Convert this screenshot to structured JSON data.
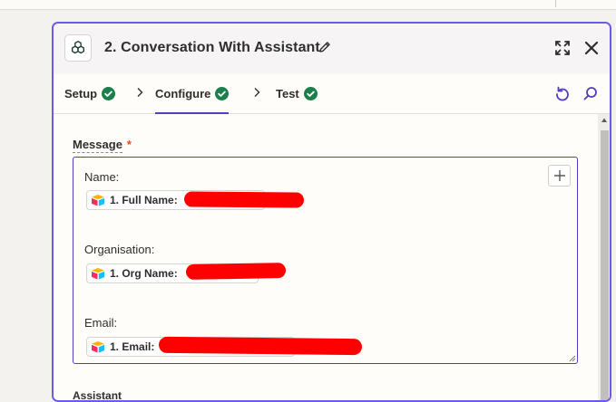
{
  "step": {
    "number": "2.",
    "title": "Conversation With Assistant"
  },
  "tabs": [
    {
      "label": "Setup",
      "complete": true
    },
    {
      "label": "Configure",
      "complete": true,
      "active": true
    },
    {
      "label": "Test",
      "complete": true
    }
  ],
  "fields": {
    "message": {
      "label": "Message",
      "required_mark": "*",
      "lines": [
        {
          "label": "Name:",
          "pill": "1. Full Name:",
          "redacted": true
        },
        {
          "label": "Organisation:",
          "pill": "1. Org Name:",
          "redacted": true
        },
        {
          "label": "Email:",
          "pill": "1. Email:",
          "redacted": true
        }
      ]
    },
    "next_field_label": "Assistant"
  },
  "colors": {
    "panel_border": "#695be8",
    "active_tab_underline": "#503ebd",
    "check_green": "#1a7f4b",
    "required_asterisk": "#e24e1b",
    "redaction": "#ff0000",
    "tool_icon": "#503ebd"
  },
  "icons": {
    "app": "openai-logo-icon",
    "edit": "pencil-icon",
    "expand": "expand-icon",
    "close": "close-icon",
    "tab_complete": "check-circle-icon",
    "tab_separator": "chevron-right-icon",
    "refresh": "refresh-icon",
    "search": "search-icon",
    "insert_data": "plus-icon",
    "pill_source": "airtable-logo-icon"
  }
}
